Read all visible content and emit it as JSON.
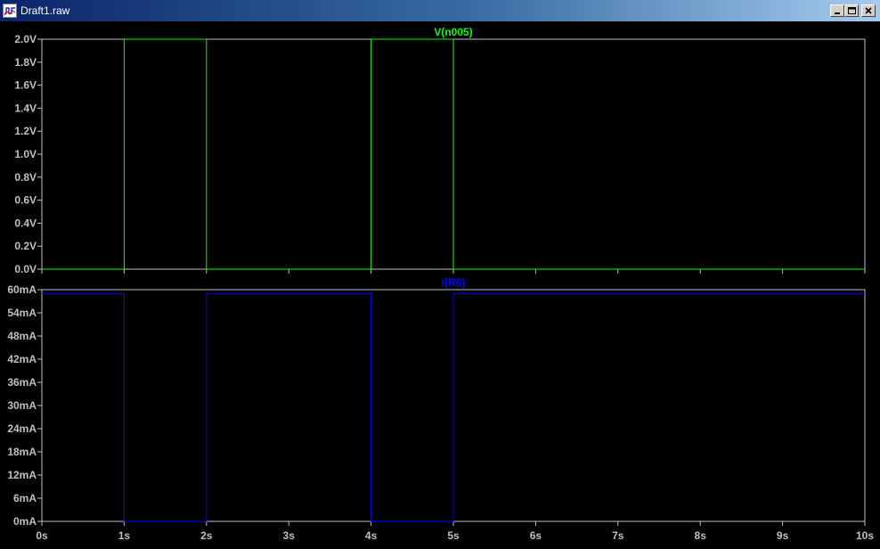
{
  "window": {
    "title": "Draft1.raw",
    "icons": {
      "app": "waveform-app-icon",
      "minimize": "minimize-icon",
      "maximize": "maximize-icon",
      "close": "close-icon"
    }
  },
  "colors": {
    "background": "#000000",
    "axis": "#c0c0c0",
    "label": "#c0c0c0",
    "trace_voltage": "#00ff00",
    "trace_current": "#0000ff"
  },
  "chart_data": [
    {
      "type": "line",
      "title": "V(n005)",
      "xlim": [
        0,
        10
      ],
      "ylim": [
        0,
        2.0
      ],
      "yticks": [
        "0.0V",
        "0.2V",
        "0.4V",
        "0.6V",
        "0.8V",
        "1.0V",
        "1.2V",
        "1.4V",
        "1.6V",
        "1.8V",
        "2.0V"
      ],
      "grid": false,
      "series": [
        {
          "name": "V(n005)",
          "color": "#00ff00",
          "x": [
            0,
            1,
            1,
            2,
            2,
            4,
            4,
            5,
            5,
            10
          ],
          "y": [
            0,
            0,
            2,
            2,
            0,
            0,
            2,
            2,
            0,
            0
          ]
        }
      ]
    },
    {
      "type": "line",
      "title": "I(R6)",
      "xlim": [
        0,
        10
      ],
      "ylim": [
        0,
        60
      ],
      "yticks": [
        "0mA",
        "6mA",
        "12mA",
        "18mA",
        "24mA",
        "30mA",
        "36mA",
        "42mA",
        "48mA",
        "54mA",
        "60mA"
      ],
      "xticks": [
        "0s",
        "1s",
        "2s",
        "3s",
        "4s",
        "5s",
        "6s",
        "7s",
        "8s",
        "9s",
        "10s"
      ],
      "grid": false,
      "series": [
        {
          "name": "I(R6)",
          "color": "#0000ff",
          "x": [
            0,
            1,
            1,
            2,
            2,
            4,
            4,
            5,
            5,
            10
          ],
          "y": [
            59,
            59,
            0,
            0,
            59,
            59,
            0,
            0,
            59,
            59
          ]
        }
      ]
    }
  ]
}
